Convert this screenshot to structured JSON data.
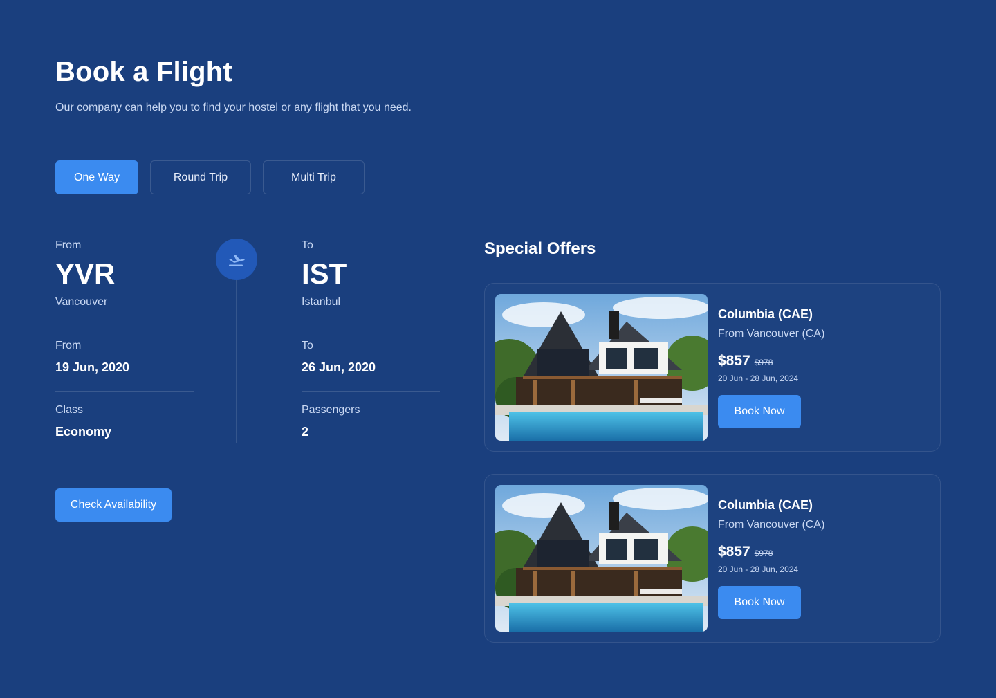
{
  "header": {
    "title": "Book a Flight",
    "subtitle": "Our company can help you to find your hostel or any flight that you need."
  },
  "tabs": [
    {
      "label": "One Way",
      "active": true
    },
    {
      "label": "Round Trip",
      "active": false
    },
    {
      "label": "Multi Trip",
      "active": false
    }
  ],
  "flight": {
    "origin": {
      "label": "From",
      "code": "YVR",
      "city": "Vancouver"
    },
    "destination": {
      "label": "To",
      "code": "IST",
      "city": "Istanbul"
    },
    "depart": {
      "label": "From",
      "value": "19 Jun, 2020"
    },
    "return": {
      "label": "To",
      "value": "26 Jun, 2020"
    },
    "class": {
      "label": "Class",
      "value": "Economy"
    },
    "passengers": {
      "label": "Passengers",
      "value": "2"
    },
    "icon": "plane-departure-icon"
  },
  "check_button": "Check Availability",
  "offers": {
    "title": "Special Offers",
    "items": [
      {
        "name": "Columbia (CAE)",
        "from": "From Vancouver (CA)",
        "price": "$857",
        "old_price": "$978",
        "dates": "20 Jun - 28 Jun, 2024",
        "button": "Book Now"
      },
      {
        "name": "Columbia (CAE)",
        "from": "From Vancouver (CA)",
        "price": "$857",
        "old_price": "$978",
        "dates": "20 Jun - 28 Jun, 2024",
        "button": "Book Now"
      }
    ]
  },
  "colors": {
    "background": "#1a3f7e",
    "accent": "#3b8bf0",
    "muted_text": "#c9d8f3"
  }
}
